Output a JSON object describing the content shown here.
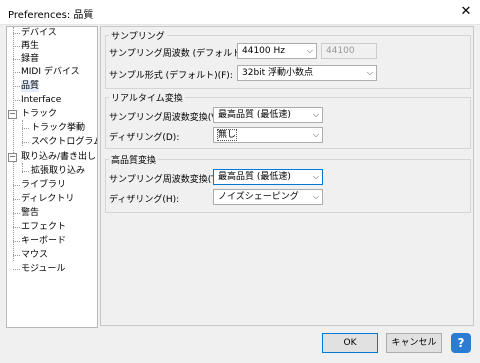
{
  "window": {
    "title": "Preferences: 品質",
    "close_glyph": "✕"
  },
  "tree": {
    "items": [
      {
        "label": "デバイス"
      },
      {
        "label": "再生"
      },
      {
        "label": "録音"
      },
      {
        "label": "MIDI デバイス"
      },
      {
        "label": "品質"
      },
      {
        "label": "Interface"
      },
      {
        "label": "トラック",
        "expander": "−"
      },
      {
        "label": "トラック挙動"
      },
      {
        "label": "スペクトログラム"
      },
      {
        "label": "取り込み/書き出し",
        "expander": "−"
      },
      {
        "label": "拡張取り込み"
      },
      {
        "label": "ライブラリ"
      },
      {
        "label": "ディレクトリ"
      },
      {
        "label": "警告"
      },
      {
        "label": "エフェクト"
      },
      {
        "label": "キーボード"
      },
      {
        "label": "マウス"
      },
      {
        "label": "モジュール"
      }
    ]
  },
  "sampling": {
    "title": "サンプリング",
    "rate_label": "サンプリング周波数 (デフォルト)(R):",
    "rate_value": "44100 Hz",
    "rate_custom": "44100",
    "format_label": "サンプル形式 (デフォルト)(F):",
    "format_value": "32bit 浮動小数点"
  },
  "realtime": {
    "title": "リアルタイム変換",
    "converter_label": "サンプリング周波数変換(V):",
    "converter_value": "最高品質 (最低速)",
    "dither_label": "ディザリング(D):",
    "dither_value": "無し"
  },
  "hq": {
    "title": "高品質変換",
    "converter_label": "サンプリング周波数変換(T):",
    "converter_value": "最高品質 (最低速)",
    "dither_label": "ディザリング(H):",
    "dither_value": "ノイズシェーピング"
  },
  "buttons": {
    "ok": "OK",
    "cancel": "キャンセル",
    "help": "?"
  },
  "colors": {
    "accent": "#0078d7",
    "help_bg": "#2b7cd3",
    "tree_selected": "#e3ecfa"
  }
}
